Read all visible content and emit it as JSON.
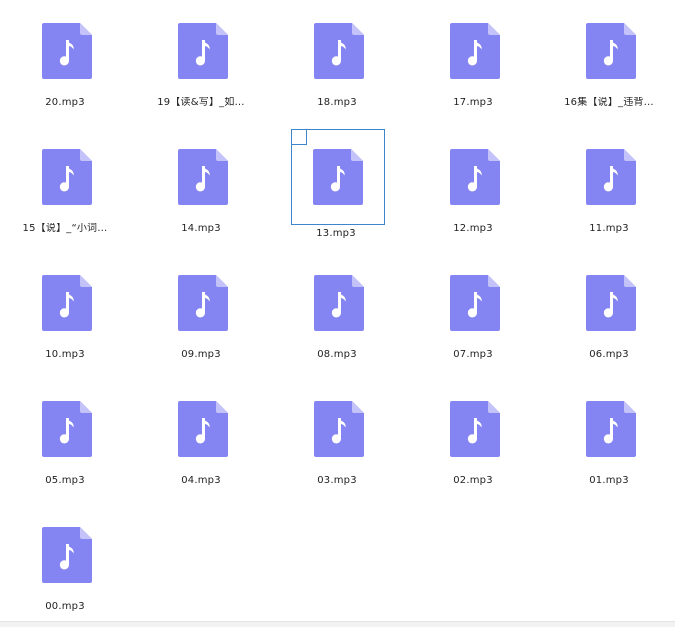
{
  "files": [
    {
      "name": "20.mp3"
    },
    {
      "name": "19【读&写】_如…"
    },
    {
      "name": "18.mp3"
    },
    {
      "name": "17.mp3"
    },
    {
      "name": "16集【说】_违背…"
    },
    {
      "name": "15【说】_“小词…"
    },
    {
      "name": "14.mp3"
    },
    {
      "name": "13.mp3",
      "selected": true
    },
    {
      "name": "12.mp3"
    },
    {
      "name": "11.mp3"
    },
    {
      "name": "10.mp3"
    },
    {
      "name": "09.mp3"
    },
    {
      "name": "08.mp3"
    },
    {
      "name": "07.mp3"
    },
    {
      "name": "06.mp3"
    },
    {
      "name": "05.mp3"
    },
    {
      "name": "04.mp3"
    },
    {
      "name": "03.mp3"
    },
    {
      "name": "02.mp3"
    },
    {
      "name": "01.mp3"
    },
    {
      "name": "00.mp3"
    }
  ],
  "icon": "audio-file-icon",
  "colors": {
    "icon_body": "#8484f2",
    "icon_fold": "#c3c3f9",
    "icon_glyph": "#ffffff",
    "selection": "#3c86c9"
  }
}
